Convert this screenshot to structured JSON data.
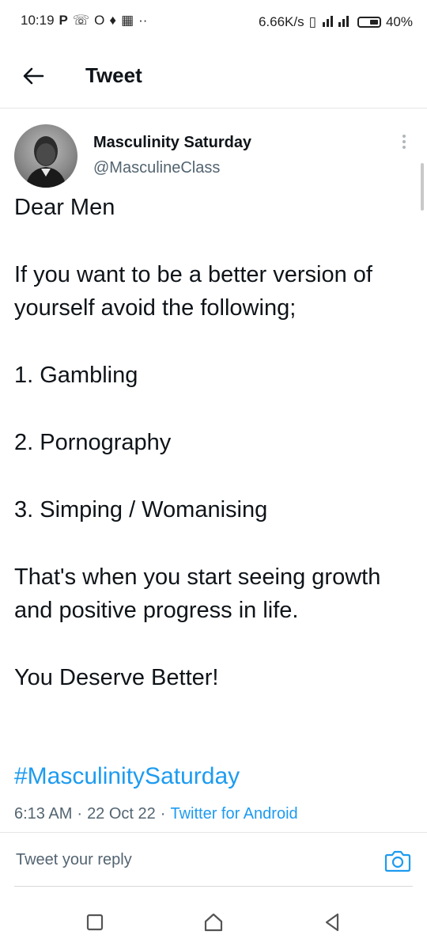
{
  "status_bar": {
    "time": "10:19",
    "speed": "6.66K/s",
    "battery": "40%",
    "icons_left": [
      "p-icon",
      "whatsapp-icon",
      "circle-icon",
      "puzzle-icon",
      "office-icon",
      "more-dots-icon"
    ],
    "icons_right": [
      "vibrate-icon",
      "signal-icon",
      "battery-icon"
    ]
  },
  "header": {
    "title": "Tweet"
  },
  "tweet": {
    "author_name": "Masculinity Saturday",
    "author_handle": "@MasculineClass",
    "body": {
      "line1": "Dear Men",
      "line2": "If you want to be a better version of yourself avoid  the following;",
      "item1": "1. Gambling",
      "item2": "2. Pornography",
      "item3": "3. Simping / Womanising",
      "line3": "That's when you start seeing growth and positive progress in life.",
      "line4": "You Deserve Better!"
    },
    "hashtag": "#MasculinitySaturday",
    "time": "6:13 AM",
    "date": "22 Oct 22",
    "source": "Twitter for Android",
    "separator": "·"
  },
  "reply": {
    "placeholder": "Tweet your reply"
  },
  "colors": {
    "accent": "#1d9bf0",
    "text": "#0f1419",
    "muted": "#536471"
  }
}
